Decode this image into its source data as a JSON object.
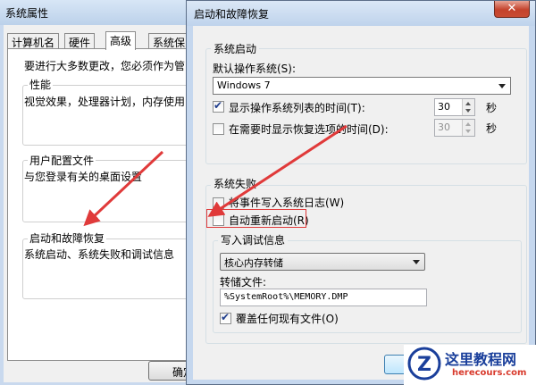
{
  "bg_window": {
    "title": "系统属性",
    "tabs": [
      "计算机名",
      "硬件",
      "高级",
      "系统保"
    ],
    "active_tab": "高级",
    "intro": "要进行大多数更改，您必须作为管",
    "performance": {
      "label": "性能",
      "desc": "视觉效果，处理器计划，内存使用"
    },
    "user_profile": {
      "label": "用户配置文件",
      "desc": "与您登录有关的桌面设置"
    },
    "startup_recovery": {
      "label": "启动和故障恢复",
      "desc": "系统启动、系统失败和调试信息"
    },
    "ok_button": "确定"
  },
  "dialog": {
    "title": "启动和故障恢复",
    "close_symbol": "✕",
    "system_startup": {
      "group_label": "系统启动",
      "default_os_label": "默认操作系统(S):",
      "default_os_value": "Windows 7",
      "show_os_list": {
        "label": "显示操作系统列表的时间(T):",
        "checked": true,
        "value": "30",
        "unit": "秒"
      },
      "show_recovery": {
        "label": "在需要时显示恢复选项的时间(D):",
        "checked": false,
        "value": "30",
        "unit": "秒"
      }
    },
    "system_failure": {
      "group_label": "系统失败",
      "write_event": {
        "label": "将事件写入系统日志(W)",
        "checked": false
      },
      "auto_restart": {
        "label": "自动重新启动(R)",
        "checked": false
      },
      "debug_info": {
        "group_label": "写入调试信息",
        "dump_type": "核心内存转储",
        "dump_file_label": "转储文件:",
        "dump_file_value": "%SystemRoot%\\MEMORY.DMP",
        "overwrite": {
          "label": "覆盖任何现有文件(O)",
          "checked": true
        }
      }
    }
  },
  "watermark": {
    "name": "这里教程网",
    "url": "herecours.com",
    "logo_letter": "Z"
  },
  "colors": {
    "annotation_red": "#e03a3a",
    "close_red": "#c4422c",
    "watermark_blue": "#1a3f9b"
  }
}
